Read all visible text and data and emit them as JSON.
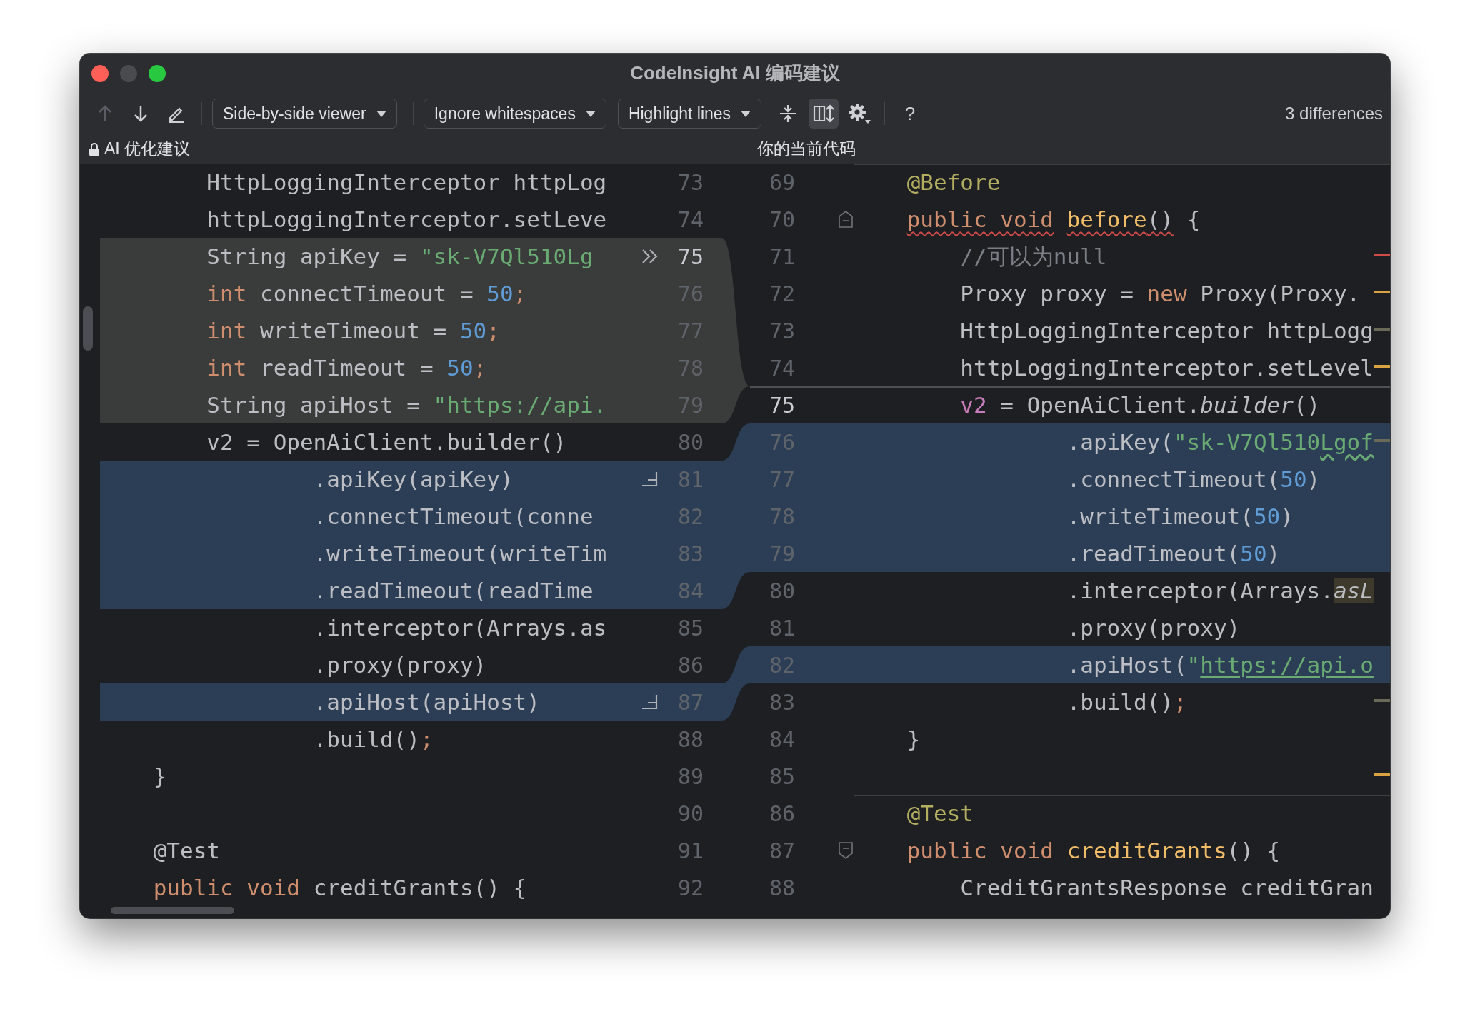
{
  "window": {
    "title": "CodeInsight AI 编码建议",
    "traffic_lights": [
      {
        "kind": "close",
        "disabled": false
      },
      {
        "kind": "minimize",
        "disabled": true
      },
      {
        "kind": "zoom",
        "disabled": false
      }
    ]
  },
  "toolbar": {
    "nav": [
      {
        "kind": "prev",
        "disabled": true
      },
      {
        "kind": "next",
        "disabled": false
      }
    ],
    "dropdowns": [
      {
        "label": "Side-by-side viewer"
      },
      {
        "label": "Ignore whitespaces"
      },
      {
        "label": "Highlight lines"
      }
    ],
    "toggles": [
      {
        "kind": "collapse",
        "selected": false
      },
      {
        "kind": "sync",
        "selected": true
      }
    ],
    "help": "?",
    "status": "3 differences"
  },
  "headers": {
    "left": {
      "label": "AI 优化建议",
      "locked": true
    },
    "right": {
      "label": "你的当前代码"
    }
  },
  "left": {
    "rows": [
      {
        "num": "73",
        "kind": "unchanged",
        "current": false,
        "code": [
          {
            "t": "        HttpLoggingInterceptor httpLog",
            "kind": "plain"
          }
        ]
      },
      {
        "num": "74",
        "kind": "unchanged",
        "current": false,
        "code": [
          {
            "t": "        httpLoggingInterceptor.setLeve",
            "kind": "plain"
          }
        ]
      },
      {
        "num": "75",
        "kind": "deleted",
        "current": true,
        "gutter_action": {
          "kind": "apply-all"
        },
        "code": [
          {
            "t": "        String apiKey = ",
            "kind": "plain"
          },
          {
            "t": "\"sk-V7Ql510Lg",
            "kind": "string"
          }
        ]
      },
      {
        "num": "76",
        "kind": "deleted",
        "current": false,
        "code": [
          {
            "t": "        int",
            "kind": "keyword"
          },
          {
            "t": " connectTimeout = ",
            "kind": "plain"
          },
          {
            "t": "50",
            "kind": "number"
          },
          {
            "t": ";",
            "kind": "keyword"
          }
        ]
      },
      {
        "num": "77",
        "kind": "deleted",
        "current": false,
        "code": [
          {
            "t": "        int",
            "kind": "keyword"
          },
          {
            "t": " writeTimeout = ",
            "kind": "plain"
          },
          {
            "t": "50",
            "kind": "number"
          },
          {
            "t": ";",
            "kind": "keyword"
          }
        ]
      },
      {
        "num": "78",
        "kind": "deleted",
        "current": false,
        "code": [
          {
            "t": "        int",
            "kind": "keyword"
          },
          {
            "t": " readTimeout = ",
            "kind": "plain"
          },
          {
            "t": "50",
            "kind": "number"
          },
          {
            "t": ";",
            "kind": "keyword"
          }
        ]
      },
      {
        "num": "79",
        "kind": "deleted",
        "current": false,
        "code": [
          {
            "t": "        String apiHost = ",
            "kind": "plain"
          },
          {
            "t": "\"https://api.",
            "kind": "string"
          }
        ]
      },
      {
        "num": "80",
        "kind": "unchanged",
        "current": false,
        "code": [
          {
            "t": "        v2 = OpenAiClient.builder()",
            "kind": "plain"
          }
        ]
      },
      {
        "num": "81",
        "kind": "modified",
        "current": false,
        "gutter_action": {
          "kind": "apply"
        },
        "code": [
          {
            "t": "                .apiKey(apiKey)",
            "kind": "plain"
          }
        ]
      },
      {
        "num": "82",
        "kind": "modified",
        "current": false,
        "code": [
          {
            "t": "                .connectTimeout(conne",
            "kind": "plain"
          }
        ]
      },
      {
        "num": "83",
        "kind": "modified",
        "current": false,
        "code": [
          {
            "t": "                .writeTimeout(writeTim",
            "kind": "plain"
          }
        ]
      },
      {
        "num": "84",
        "kind": "modified",
        "current": false,
        "code": [
          {
            "t": "                .readTimeout(readTime",
            "kind": "plain"
          }
        ]
      },
      {
        "num": "85",
        "kind": "unchanged",
        "current": false,
        "code": [
          {
            "t": "                .interceptor(Arrays.as",
            "kind": "plain"
          }
        ]
      },
      {
        "num": "86",
        "kind": "unchanged",
        "current": false,
        "code": [
          {
            "t": "                .proxy(proxy)",
            "kind": "plain"
          }
        ]
      },
      {
        "num": "87",
        "kind": "modified",
        "current": false,
        "gutter_action": {
          "kind": "apply"
        },
        "code": [
          {
            "t": "                .apiHost(apiHost)",
            "kind": "plain"
          }
        ]
      },
      {
        "num": "88",
        "kind": "unchanged",
        "current": false,
        "code": [
          {
            "t": "                .build()",
            "kind": "plain"
          },
          {
            "t": ";",
            "kind": "keyword"
          }
        ]
      },
      {
        "num": "89",
        "kind": "unchanged",
        "current": false,
        "code": [
          {
            "t": "    }",
            "kind": "plain"
          }
        ]
      },
      {
        "num": "90",
        "kind": "unchanged",
        "current": false
      },
      {
        "num": "91",
        "kind": "unchanged",
        "current": false,
        "code": [
          {
            "t": "    @Test",
            "kind": "plain"
          }
        ]
      },
      {
        "num": "92",
        "kind": "unchanged",
        "current": false,
        "code": [
          {
            "t": "    public void",
            "kind": "keyword"
          },
          {
            "t": " creditGrants() {",
            "kind": "plain"
          }
        ]
      }
    ]
  },
  "right": {
    "rows": [
      {
        "num": "69",
        "kind": "unchanged",
        "current": false,
        "separator_above": true,
        "code": [
          {
            "t": "    @Before",
            "kind": "annotation"
          }
        ]
      },
      {
        "num": "70",
        "kind": "unchanged",
        "current": false,
        "fold": {
          "kind": "up"
        },
        "code": [
          {
            "t": "    public void",
            "kind": "keyword",
            "decoration": {
              "kind": "error"
            }
          },
          {
            "t": " before",
            "kind": "method",
            "decoration": {
              "kind": "error"
            }
          },
          {
            "t": "()",
            "kind": "plain",
            "decoration": {
              "kind": "error"
            }
          },
          {
            "t": " {",
            "kind": "plain"
          }
        ]
      },
      {
        "num": "71",
        "kind": "unchanged",
        "current": false,
        "stripe": {
          "kind": "error"
        },
        "code": [
          {
            "t": "        //可以为null",
            "kind": "comment"
          }
        ]
      },
      {
        "num": "72",
        "kind": "unchanged",
        "current": false,
        "stripe": {
          "kind": "warning"
        },
        "code": [
          {
            "t": "        Proxy proxy = ",
            "kind": "plain"
          },
          {
            "t": "new",
            "kind": "keyword"
          },
          {
            "t": " Proxy(Proxy.",
            "kind": "plain"
          }
        ]
      },
      {
        "num": "73",
        "kind": "unchanged",
        "current": false,
        "stripe": {
          "kind": "info"
        },
        "code": [
          {
            "t": "        HttpLoggingInterceptor httpLogg",
            "kind": "plain"
          }
        ]
      },
      {
        "num": "74",
        "kind": "unchanged",
        "current": false,
        "stripe": {
          "kind": "warning"
        },
        "code": [
          {
            "t": "        httpLoggingInterceptor.setLevel",
            "kind": "plain"
          }
        ]
      },
      {
        "num": "75",
        "kind": "unchanged",
        "current": true,
        "deleted_above": true,
        "code": [
          {
            "t": "        v2",
            "kind": "field"
          },
          {
            "t": " = OpenAiClient.",
            "kind": "plain"
          },
          {
            "t": "builder",
            "kind": "italic"
          },
          {
            "t": "()",
            "kind": "plain"
          }
        ]
      },
      {
        "num": "76",
        "kind": "modified",
        "current": false,
        "stripe": {
          "kind": "info"
        },
        "code": [
          {
            "t": "                .apiKey(",
            "kind": "plain"
          },
          {
            "t": "\"sk-V7Ql510",
            "kind": "string"
          },
          {
            "t": "Lgof",
            "kind": "string",
            "decoration": {
              "kind": "typo"
            }
          }
        ]
      },
      {
        "num": "77",
        "kind": "modified",
        "current": false,
        "code": [
          {
            "t": "                .connectTimeout(",
            "kind": "plain"
          },
          {
            "t": "50",
            "kind": "number"
          },
          {
            "t": ")",
            "kind": "plain"
          }
        ]
      },
      {
        "num": "78",
        "kind": "modified",
        "current": false,
        "code": [
          {
            "t": "                .writeTimeout(",
            "kind": "plain"
          },
          {
            "t": "50",
            "kind": "number"
          },
          {
            "t": ")",
            "kind": "plain"
          }
        ]
      },
      {
        "num": "79",
        "kind": "modified",
        "current": false,
        "code": [
          {
            "t": "                .readTimeout(",
            "kind": "plain"
          },
          {
            "t": "50",
            "kind": "number"
          },
          {
            "t": ")",
            "kind": "plain"
          }
        ]
      },
      {
        "num": "80",
        "kind": "unchanged",
        "current": false,
        "code": [
          {
            "t": "                .interceptor(Arrays.",
            "kind": "plain"
          },
          {
            "t": "asL",
            "kind": "italic",
            "decoration": {
              "kind": "highlight"
            }
          }
        ]
      },
      {
        "num": "81",
        "kind": "unchanged",
        "current": false,
        "code": [
          {
            "t": "                .proxy(proxy)",
            "kind": "plain"
          }
        ]
      },
      {
        "num": "82",
        "kind": "modified",
        "current": false,
        "code": [
          {
            "t": "                .apiHost(",
            "kind": "plain"
          },
          {
            "t": "\"",
            "kind": "string"
          },
          {
            "t": "https://api.o",
            "kind": "string",
            "decoration": {
              "kind": "link"
            }
          }
        ]
      },
      {
        "num": "83",
        "kind": "unchanged",
        "current": false,
        "stripe": {
          "kind": "info"
        },
        "code": [
          {
            "t": "                .build()",
            "kind": "plain"
          },
          {
            "t": ";",
            "kind": "keyword"
          }
        ]
      },
      {
        "num": "84",
        "kind": "unchanged",
        "current": false,
        "code": [
          {
            "t": "    }",
            "kind": "plain"
          }
        ]
      },
      {
        "num": "85",
        "kind": "unchanged",
        "current": false,
        "stripe": {
          "kind": "warning"
        }
      },
      {
        "num": "86",
        "kind": "unchanged",
        "current": false,
        "separator_above": true,
        "code": [
          {
            "t": "    @Test",
            "kind": "annotation"
          }
        ]
      },
      {
        "num": "87",
        "kind": "unchanged",
        "current": false,
        "fold": {
          "kind": "down"
        },
        "code": [
          {
            "t": "    public void",
            "kind": "keyword"
          },
          {
            "t": " creditGrants",
            "kind": "method"
          },
          {
            "t": "() {",
            "kind": "plain"
          }
        ]
      },
      {
        "num": "88",
        "kind": "unchanged",
        "current": false,
        "code": [
          {
            "t": "        CreditGrantsResponse creditGran",
            "kind": "plain"
          }
        ]
      }
    ]
  }
}
